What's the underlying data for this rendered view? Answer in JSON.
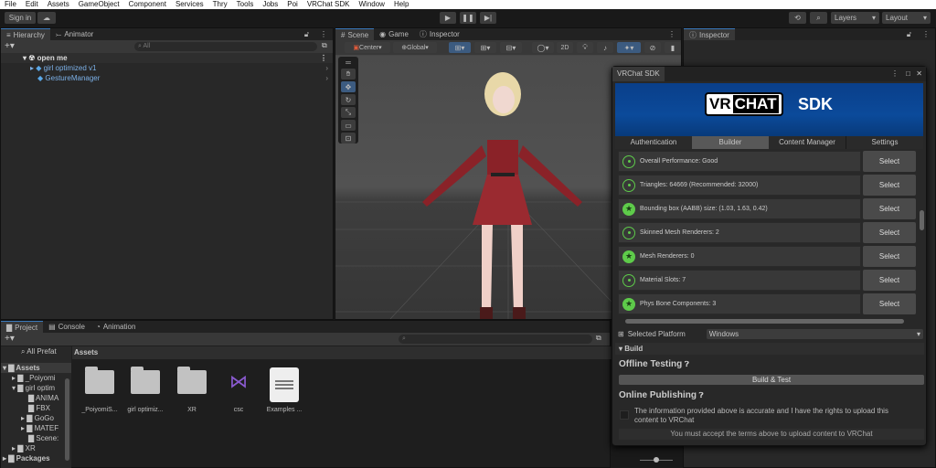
{
  "menu": [
    "File",
    "Edit",
    "Assets",
    "GameObject",
    "Component",
    "Services",
    "Thry",
    "Tools",
    "Jobs",
    "Poi",
    "VRChat SDK",
    "Window",
    "Help"
  ],
  "toolbar": {
    "sign_in": "Sign in",
    "layers": "Layers",
    "layout": "Layout"
  },
  "hierarchy": {
    "tabs": [
      "Hierarchy",
      "Animator"
    ],
    "search_placeholder": "All",
    "scene": "open me",
    "items": [
      "girl optimized v1",
      "GestureManager"
    ]
  },
  "scene": {
    "tabs": [
      "Scene",
      "Game",
      "Inspector"
    ],
    "pivot": "Center",
    "space": "Global",
    "mode_2d": "2D"
  },
  "inspector": {
    "tab": "Inspector"
  },
  "project": {
    "tabs": [
      "Project",
      "Console",
      "Animation"
    ],
    "search_filter": "All Prefat",
    "tree": [
      "Assets",
      "_Poiyomi",
      "girl optim",
      "ANIMA",
      "FBX",
      "GoGo",
      "MATEF",
      "Scene:",
      "XR",
      "Packages"
    ],
    "breadcrumb": "Assets",
    "assets": [
      "_PoiyomiS...",
      "girl optimiz...",
      "XR",
      "csc",
      "Examples ..."
    ]
  },
  "sdk": {
    "title": "VRChat SDK",
    "banner_vr": "VR",
    "banner_chat": "CHAT",
    "banner_sdk": "SDK",
    "tabs": [
      "Authentication",
      "Builder",
      "Content Manager",
      "Settings"
    ],
    "checks": [
      {
        "text": "Overall Performance: Good",
        "status": "good"
      },
      {
        "text": "Triangles: 64669 (Recommended: 32000)",
        "status": "good"
      },
      {
        "text": "Bounding box (AABB) size: (1.03, 1.63, 0.42)",
        "status": "excellent"
      },
      {
        "text": "Skinned Mesh Renderers: 2",
        "status": "good"
      },
      {
        "text": "Mesh Renderers: 0",
        "status": "excellent"
      },
      {
        "text": "Material Slots: 7",
        "status": "good"
      },
      {
        "text": "Phys Bone Components: 3",
        "status": "excellent"
      }
    ],
    "select_label": "Select",
    "platform_label": "Selected Platform",
    "platform_value": "Windows",
    "build_header": "Build",
    "offline_testing": "Offline Testing",
    "build_test": "Build & Test",
    "online_publishing": "Online Publishing",
    "terms": "The information provided above is accurate and I have the rights to upload this content to VRChat",
    "terms_checked": false,
    "upload_notice": "You must accept the terms above to upload content to VRChat"
  },
  "colors": {
    "accent": "#3a79bb",
    "good": "#5ecb4a",
    "banner": "#0b4a9a"
  }
}
